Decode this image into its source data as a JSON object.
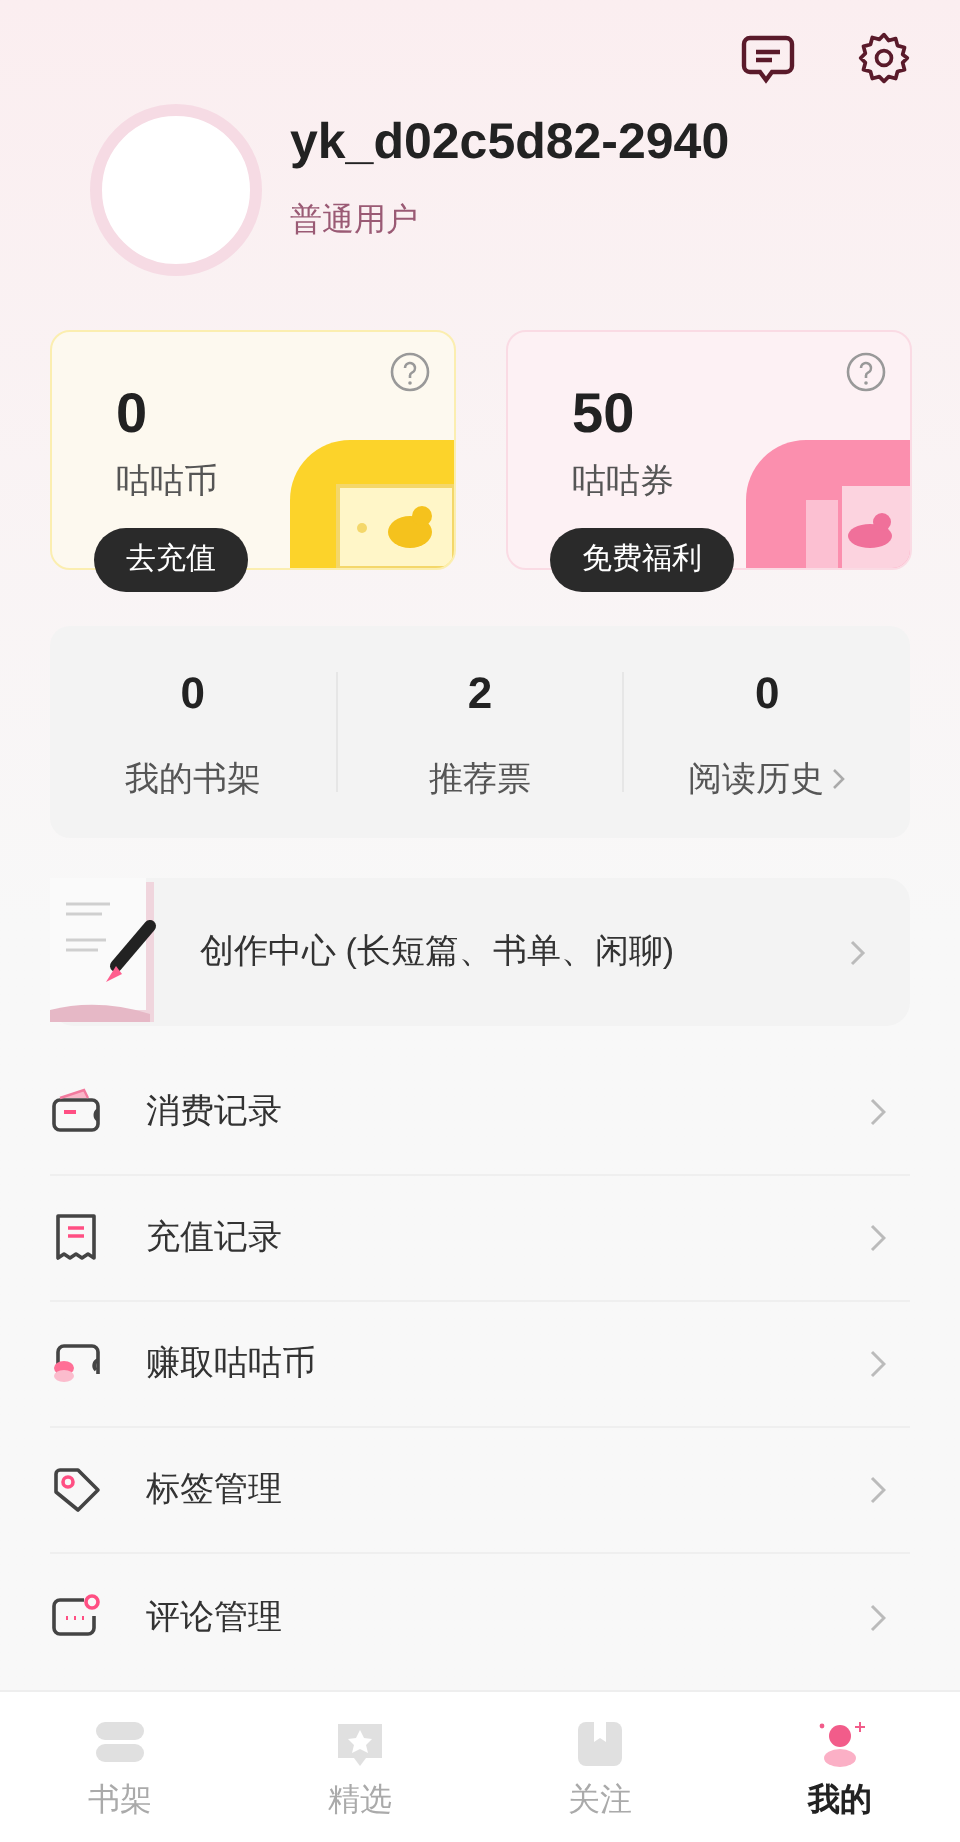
{
  "profile": {
    "username": "yk_d02c5d82-2940",
    "level": "普通用户"
  },
  "wallet_cards": [
    {
      "kind": "coin",
      "amount": "0",
      "label": "咕咕币",
      "action": "去充值"
    },
    {
      "kind": "voucher",
      "amount": "50",
      "label": "咕咕券",
      "action": "免费福利"
    }
  ],
  "stats": [
    {
      "value": "0",
      "label": "我的书架",
      "arrow": false
    },
    {
      "value": "2",
      "label": "推荐票",
      "arrow": false
    },
    {
      "value": "0",
      "label": "阅读历史",
      "arrow": true
    }
  ],
  "creation_center": {
    "label": "创作中心 (长短篇、书单、闲聊)"
  },
  "menu": [
    {
      "kind": "wallet",
      "label": "消费记录"
    },
    {
      "kind": "receipt",
      "label": "充值记录"
    },
    {
      "kind": "coins",
      "label": "赚取咕咕币"
    },
    {
      "kind": "tag",
      "label": "标签管理"
    },
    {
      "kind": "comment",
      "label": "评论管理"
    }
  ],
  "tabs": [
    {
      "kind": "shelf",
      "label": "书架",
      "selected": false
    },
    {
      "kind": "featured",
      "label": "精选",
      "selected": false
    },
    {
      "kind": "follow",
      "label": "关注",
      "selected": false
    },
    {
      "kind": "me",
      "label": "我的",
      "selected": true
    }
  ]
}
